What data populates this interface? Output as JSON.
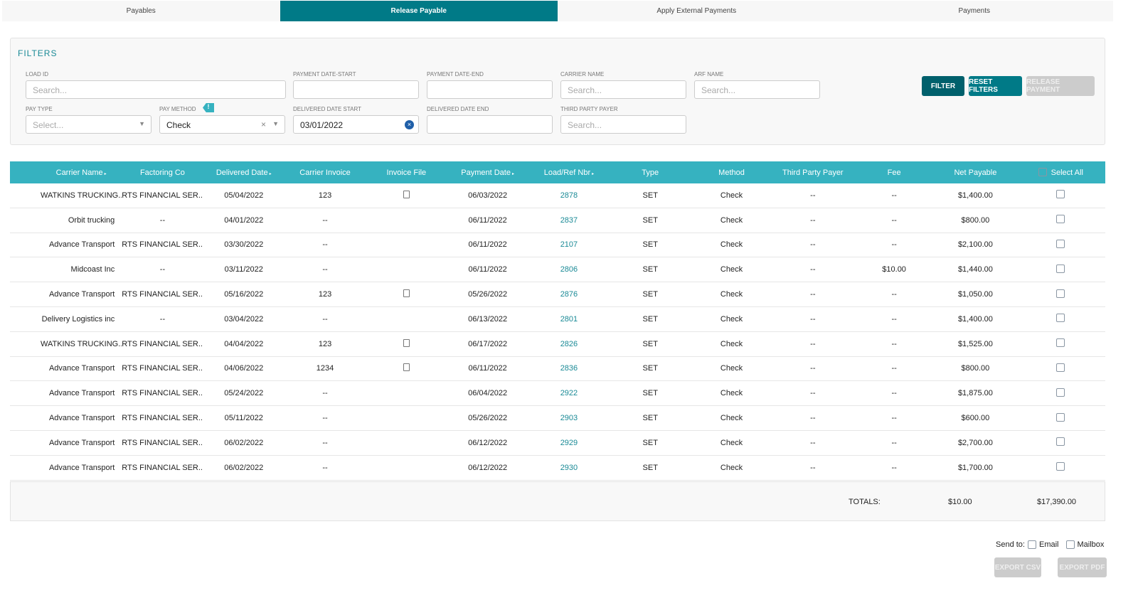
{
  "tabs": [
    "Payables",
    "Release Payable",
    "Apply External Payments",
    "Payments"
  ],
  "filters": {
    "title": "FILTERS",
    "load_id": {
      "label": "LOAD ID",
      "placeholder": "Search..."
    },
    "payment_date_start": {
      "label": "PAYMENT DATE-START",
      "value": ""
    },
    "payment_date_end": {
      "label": "PAYMENT DATE-END",
      "value": ""
    },
    "carrier_name": {
      "label": "CARRIER NAME",
      "placeholder": "Search..."
    },
    "arf_name": {
      "label": "ARF NAME",
      "placeholder": "Search..."
    },
    "pay_type": {
      "label": "PAY TYPE",
      "placeholder": "Select..."
    },
    "pay_method": {
      "label": "PAY METHOD",
      "value": "Check",
      "badge": "!"
    },
    "delivered_date_start": {
      "label": "DELIVERED DATE START",
      "value": "03/01/2022"
    },
    "delivered_date_end": {
      "label": "DELIVERED DATE END",
      "value": ""
    },
    "third_party_payer": {
      "label": "THIRD PARTY PAYER",
      "placeholder": "Search..."
    },
    "filter_label": "FILTER",
    "reset_label": "RESET FILTERS",
    "release_label": "RELEASE PAYMENT"
  },
  "table": {
    "columns": [
      "Carrier Name",
      "Factoring Co",
      "Delivered Date",
      "Carrier Invoice",
      "Invoice File",
      "Payment Date",
      "Load/Ref Nbr",
      "Type",
      "Method",
      "Third Party Payer",
      "Fee",
      "Net Payable",
      "Select All"
    ],
    "rows": [
      [
        "WATKINS TRUCKING...",
        "RTS FINANCIAL SER...",
        "05/04/2022",
        "123",
        true,
        "06/03/2022",
        "2878",
        "SET",
        "Check",
        "--",
        "--",
        "$1,400.00"
      ],
      [
        "Orbit trucking",
        "--",
        "04/01/2022",
        "--",
        false,
        "06/11/2022",
        "2837",
        "SET",
        "Check",
        "--",
        "--",
        "$800.00"
      ],
      [
        "Advance Transport",
        "RTS FINANCIAL SER...",
        "03/30/2022",
        "--",
        false,
        "06/11/2022",
        "2107",
        "SET",
        "Check",
        "--",
        "--",
        "$2,100.00"
      ],
      [
        "Midcoast Inc",
        "--",
        "03/11/2022",
        "--",
        false,
        "06/11/2022",
        "2806",
        "SET",
        "Check",
        "--",
        "$10.00",
        "$1,440.00"
      ],
      [
        "Advance Transport",
        "RTS FINANCIAL SER...",
        "05/16/2022",
        "123",
        true,
        "05/26/2022",
        "2876",
        "SET",
        "Check",
        "--",
        "--",
        "$1,050.00"
      ],
      [
        "Delivery Logistics inc",
        "--",
        "03/04/2022",
        "--",
        false,
        "06/13/2022",
        "2801",
        "SET",
        "Check",
        "--",
        "--",
        "$1,400.00"
      ],
      [
        "WATKINS TRUCKING...",
        "RTS FINANCIAL SER...",
        "04/04/2022",
        "123",
        true,
        "06/17/2022",
        "2826",
        "SET",
        "Check",
        "--",
        "--",
        "$1,525.00"
      ],
      [
        "Advance Transport",
        "RTS FINANCIAL SER...",
        "04/06/2022",
        "1234",
        true,
        "06/11/2022",
        "2836",
        "SET",
        "Check",
        "--",
        "--",
        "$800.00"
      ],
      [
        "Advance Transport",
        "RTS FINANCIAL SER...",
        "05/24/2022",
        "--",
        false,
        "06/04/2022",
        "2922",
        "SET",
        "Check",
        "--",
        "--",
        "$1,875.00"
      ],
      [
        "Advance Transport",
        "RTS FINANCIAL SER...",
        "05/11/2022",
        "--",
        false,
        "05/26/2022",
        "2903",
        "SET",
        "Check",
        "--",
        "--",
        "$600.00"
      ],
      [
        "Advance Transport",
        "RTS FINANCIAL SER...",
        "06/02/2022",
        "--",
        false,
        "06/12/2022",
        "2929",
        "SET",
        "Check",
        "--",
        "--",
        "$2,700.00"
      ],
      [
        "Advance Transport",
        "RTS FINANCIAL SER...",
        "06/02/2022",
        "--",
        false,
        "06/12/2022",
        "2930",
        "SET",
        "Check",
        "--",
        "--",
        "$1,700.00"
      ]
    ]
  },
  "totals": {
    "label": "TOTALS:",
    "fee": "$10.00",
    "net": "$17,390.00"
  },
  "footer": {
    "send_to": "Send to:",
    "email": "Email",
    "mailbox": "Mailbox",
    "export_csv": "EXPORT CSV",
    "export_pdf": "EXPORT PDF"
  },
  "colors": {
    "accent": "#007a87",
    "header": "#36b2c0",
    "filter_btn": "#00606c",
    "disabled": "#cccccc"
  }
}
